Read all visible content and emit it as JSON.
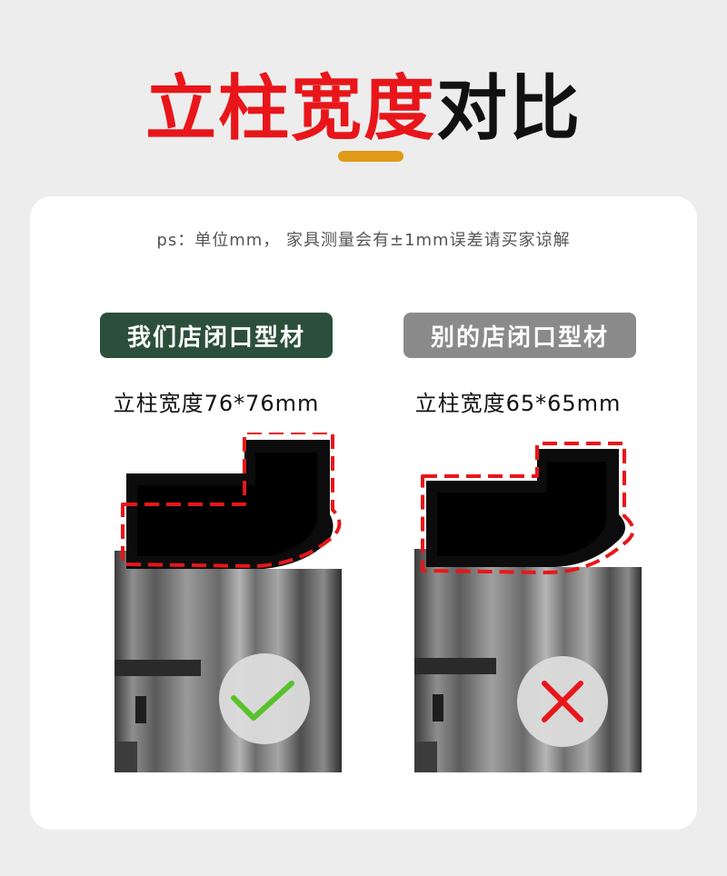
{
  "title": {
    "highlight": "立柱宽度",
    "rest": "对比"
  },
  "note": "ps：单位mm， 家具测量会有±1mm误差请买家谅解",
  "left": {
    "badge": "我们店闭口型材",
    "spec": "立柱宽度76*76mm",
    "verdict_icon": "check-icon"
  },
  "right": {
    "badge": "别的店闭口型材",
    "spec": "立柱宽度65*65mm",
    "verdict_icon": "cross-icon"
  },
  "colors": {
    "title_red": "#e8161a",
    "accent_underline": "#e09a18",
    "good_badge": "#2c4f3b",
    "bad_badge": "#8a8a8a",
    "dashed_outline": "#e8161a",
    "check": "#58c22c",
    "cross": "#e8161a"
  }
}
